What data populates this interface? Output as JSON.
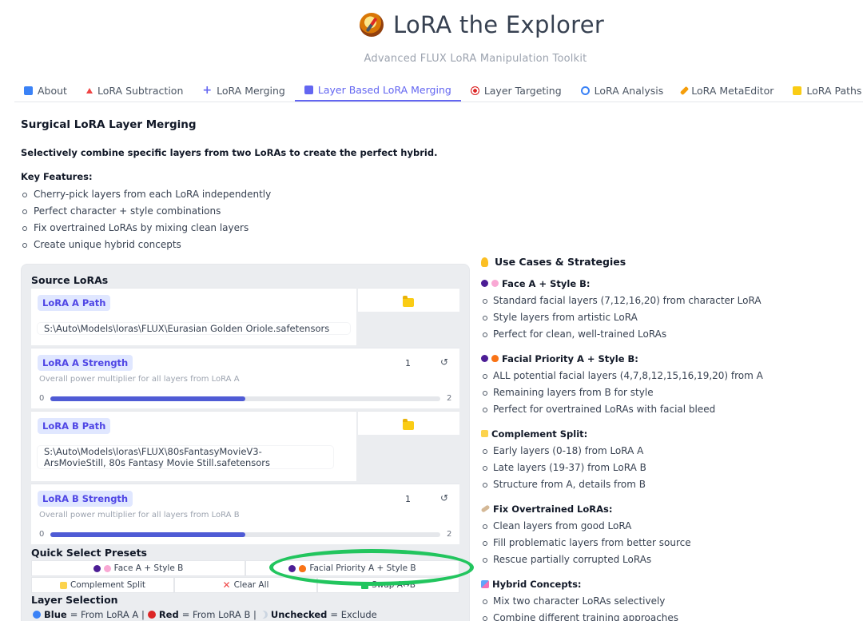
{
  "app": {
    "title": "LoRA the Explorer",
    "subtitle": "Advanced FLUX LoRA Manipulation Toolkit"
  },
  "tabs": [
    {
      "label": "About",
      "icon": "info-icon",
      "color": "#3b82f6"
    },
    {
      "label": "LoRA Subtraction",
      "icon": "triangle-icon",
      "color": "#ef4444"
    },
    {
      "label": "LoRA Merging",
      "icon": "plus-icon",
      "color": "#6366f1"
    },
    {
      "label": "Layer Based LoRA Merging",
      "icon": "layers-icon",
      "color": "#6366f1",
      "active": true
    },
    {
      "label": "Layer Targeting",
      "icon": "target-icon",
      "color": "#dc2626"
    },
    {
      "label": "LoRA Analysis",
      "icon": "magnifier-icon",
      "color": "#3b82f6"
    },
    {
      "label": "LoRA MetaEditor",
      "icon": "pencil-icon",
      "color": "#f59e0b"
    },
    {
      "label": "LoRA Paths",
      "icon": "folder-icon",
      "color": "#facc15"
    }
  ],
  "intro": {
    "heading": "Surgical LoRA Layer Merging",
    "lead": "Selectively combine specific layers from two LoRAs to create the perfect hybrid.",
    "features_title": "Key Features:",
    "features": [
      "Cherry-pick layers from each LoRA independently",
      "Perfect character + style combinations",
      "Fix overtrained LoRAs by mixing clean layers",
      "Create unique hybrid concepts"
    ]
  },
  "source": {
    "title": "Source LoRAs",
    "lora_a_path_label": "LoRA A Path",
    "lora_a_path_value": "S:\\Auto\\Models\\loras\\FLUX\\Eurasian Golden Oriole.safetensors",
    "lora_a_strength_label": "LoRA A Strength",
    "lora_a_strength_desc": "Overall power multiplier for all layers from LoRA A",
    "lora_a_strength_value": "1",
    "lora_a_min": "0",
    "lora_a_max": "2",
    "lora_a_fraction": 0.5,
    "lora_b_path_label": "LoRA B Path",
    "lora_b_path_value": "S:\\Auto\\Models\\loras\\FLUX\\80sFantasyMovieV3- ArsMovieStill, 80s Fantasy Movie Still.safetensors",
    "lora_b_strength_label": "LoRA B Strength",
    "lora_b_strength_desc": "Overall power multiplier for all layers from LoRA B",
    "lora_b_strength_value": "1",
    "lora_b_min": "0",
    "lora_b_max": "2",
    "lora_b_fraction": 0.5
  },
  "presets": {
    "title": "Quick Select Presets",
    "face_a_style_b": "Face A + Style B",
    "facial_priority": "Facial Priority A + Style B",
    "complement_split": "Complement Split",
    "clear_all": "Clear All",
    "swap": "Swap A↔B"
  },
  "layer_selection": {
    "title": "Layer Selection",
    "blue": "Blue",
    "blue_text": "= From LoRA A |",
    "red": "Red",
    "red_text": "= From LoRA B |",
    "unchecked": "Unchecked",
    "unchecked_text": "= Exclude"
  },
  "use_cases": {
    "title": "Use Cases & Strategies",
    "strategies": [
      {
        "title": "Face A + Style B:",
        "items": [
          "Standard facial layers (7,12,16,20) from character LoRA",
          "Style layers from artistic LoRA",
          "Perfect for clean, well-trained LoRAs"
        ]
      },
      {
        "title": "Facial Priority A + Style B:",
        "items": [
          "ALL potential facial layers (4,7,8,12,15,16,19,20) from A",
          "Remaining layers from B for style",
          "Perfect for overtrained LoRAs with facial bleed"
        ]
      },
      {
        "title": "Complement Split:",
        "items": [
          "Early layers (0-18) from LoRA A",
          "Late layers (19-37) from LoRA B",
          "Structure from A, details from B"
        ]
      },
      {
        "title": "Fix Overtrained LoRAs:",
        "items": [
          "Clean layers from good LoRA",
          "Fill problematic layers from better source",
          "Rescue partially corrupted LoRAs"
        ]
      },
      {
        "title": "Hybrid Concepts:",
        "items": [
          "Mix two character LoRAs selectively",
          "Combine different training approaches"
        ]
      }
    ]
  }
}
